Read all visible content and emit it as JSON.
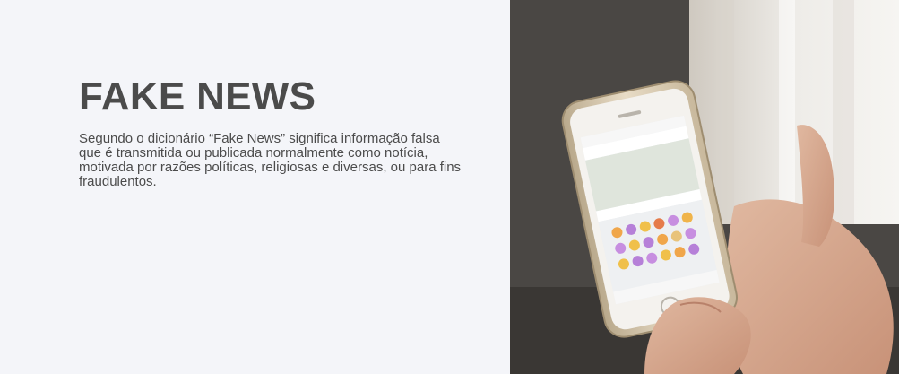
{
  "hero": {
    "title": "FAKE NEWS",
    "description": "Segundo o dicionário “Fake News” significa informação falsa que é transmitida ou publicada normalmente como notícia, motivada por razões políticas, religiosas e diversas, ou para fins fraudulentos."
  },
  "photo": {
    "icon": "smartphone-in-hand-photo"
  },
  "colors": {
    "background": "#f4f5f9",
    "text": "#4b4b4b"
  }
}
